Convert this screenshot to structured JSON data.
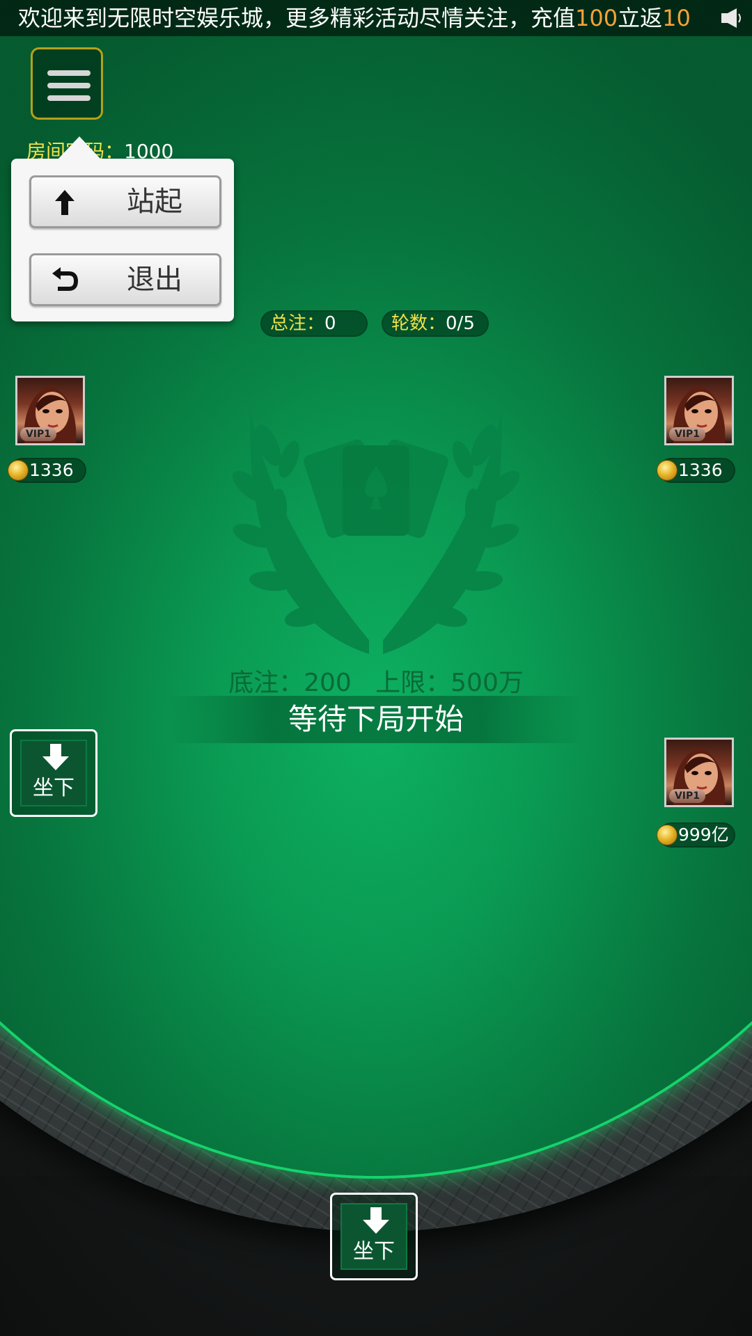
{
  "marquee": {
    "part1": "欢迎来到无限时空娱乐城，更多精彩活动尽情关注，充值",
    "amount1": "100",
    "part2": "立返",
    "amount2": "10",
    "icon": "speaker-icon"
  },
  "room": {
    "label": "房间密码：",
    "number": "1000"
  },
  "menu": {
    "icon": "hamburger-icon",
    "items": [
      {
        "label": "站起",
        "icon": "arrow-up-icon"
      },
      {
        "label": "退出",
        "icon": "return-icon"
      }
    ]
  },
  "pot": {
    "label": "总注：",
    "value": "0"
  },
  "rounds": {
    "label": "轮数：",
    "value": "0/5"
  },
  "players": [
    {
      "vip": "VIP1",
      "coins": "1336"
    },
    {
      "vip": "VIP1",
      "coins": "1336"
    },
    {
      "vip": "VIP1",
      "coins": "999亿"
    }
  ],
  "table": {
    "limits": "底注：200   上限：500万",
    "status": "等待下局开始"
  },
  "sit_buttons": [
    {
      "label": "坐下"
    },
    {
      "label": "坐下"
    }
  ],
  "colors": {
    "felt": "#099a52",
    "accent_yellow": "#f1e24a",
    "highlight_orange": "#f2a33a"
  }
}
